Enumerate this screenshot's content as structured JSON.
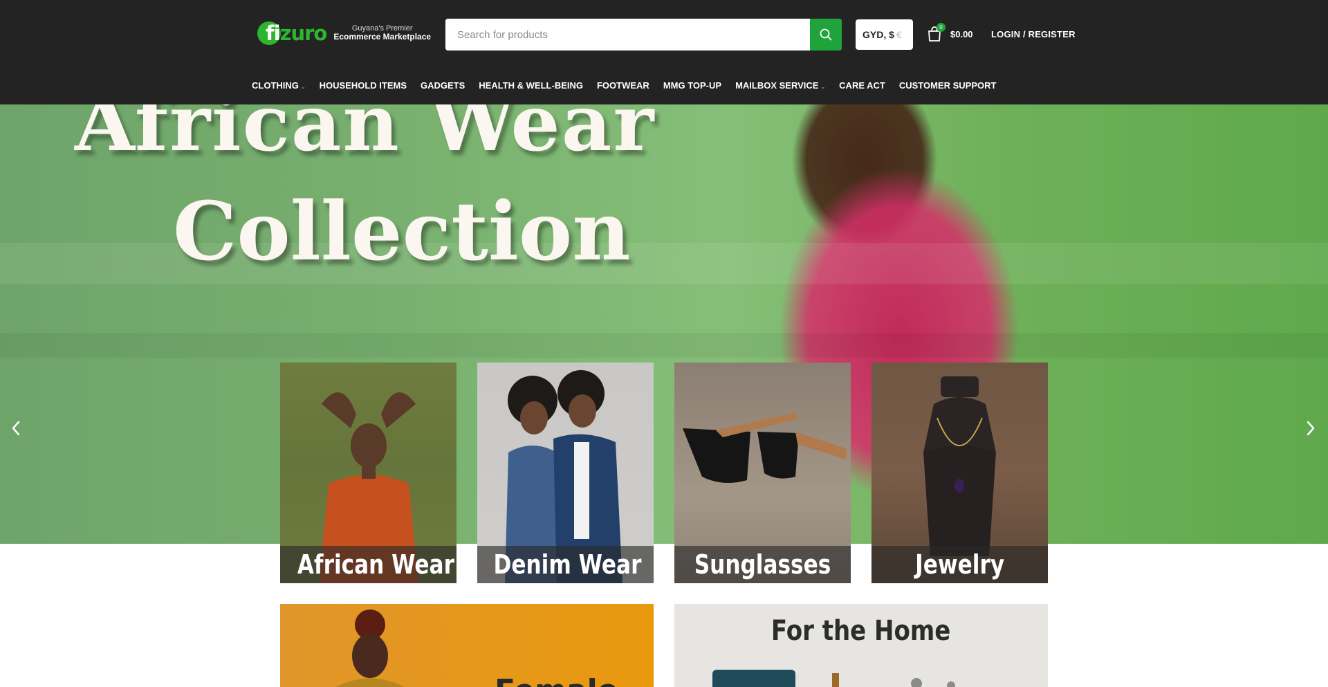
{
  "brand": {
    "logo_text_green": "fi",
    "logo_text_white": "zuro",
    "tagline_line1": "Guyana's Premier",
    "tagline_line2": "Ecommerce Marketplace"
  },
  "search": {
    "placeholder": "Search for products"
  },
  "currency": {
    "label": "GYD, $",
    "fade": "€"
  },
  "cart": {
    "count": "0",
    "total": "$0.00"
  },
  "account": {
    "login_label": "LOGIN / REGISTER"
  },
  "nav": {
    "items": [
      {
        "label": "CLOTHING",
        "has_dropdown": true
      },
      {
        "label": "HOUSEHOLD ITEMS",
        "has_dropdown": false
      },
      {
        "label": "GADGETS",
        "has_dropdown": false
      },
      {
        "label": "HEALTH & WELL-BEING",
        "has_dropdown": false
      },
      {
        "label": "FOOTWEAR",
        "has_dropdown": false
      },
      {
        "label": "MMG TOP-UP",
        "has_dropdown": false
      },
      {
        "label": "MAILBOX SERVICE",
        "has_dropdown": true
      },
      {
        "label": "CARE ACT",
        "has_dropdown": false
      },
      {
        "label": "CUSTOMER SUPPORT",
        "has_dropdown": false
      }
    ]
  },
  "hero": {
    "title_line1": "African Wear",
    "title_line2": "Collection"
  },
  "categories": [
    {
      "label": "African Wear"
    },
    {
      "label": "Denim Wear"
    },
    {
      "label": "Sunglasses"
    },
    {
      "label": "Jewelry"
    }
  ],
  "banners": {
    "left_title": "Female",
    "right_title": "For the Home"
  },
  "colors": {
    "header_bg": "#232323",
    "accent_green": "#1fa33a",
    "hero_green": "#78b06f"
  }
}
